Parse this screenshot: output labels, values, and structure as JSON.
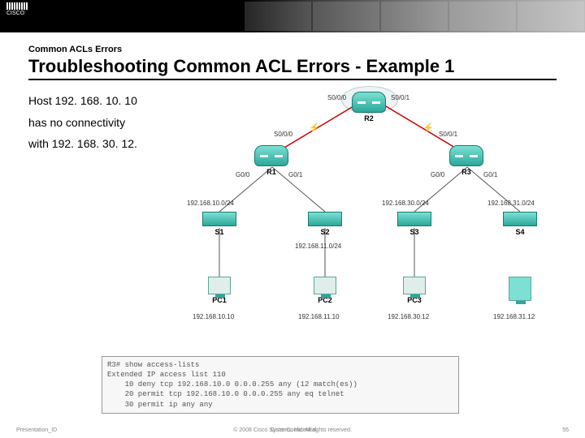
{
  "logo_text": "CISCO",
  "section_label": "Common ACLs Errors",
  "title": "Troubleshooting Common ACL Errors - Example 1",
  "body_text": {
    "l1": "Host 192. 168. 10. 10",
    "l2": "has no connectivity",
    "l3": "with 192. 168. 30. 12."
  },
  "diagram": {
    "routers": {
      "r1": "R1",
      "r2": "R2",
      "r3": "R3"
    },
    "iface": {
      "r2_s000": "S0/0/0",
      "r2_s001": "S0/0/1",
      "r1_s000": "S0/0/0",
      "r3_s001": "S0/0/1",
      "r1_g00": "G0/0",
      "r1_g01": "G0/1",
      "r3_g00": "G0/0",
      "r3_g01": "G0/1"
    },
    "switches": {
      "s1": "S1",
      "s2": "S2",
      "s3": "S3",
      "s4": "S4"
    },
    "pcs": {
      "pc1": "PC1",
      "pc2": "PC2",
      "pc3": "PC3"
    },
    "subnets": {
      "n10": "192.168.10.0/24",
      "n11": "192.168.11.0/24",
      "n30": "192.168.30.0/24",
      "n31": "192.168.31.0/24"
    },
    "hosts": {
      "h10": "192.168.10.10",
      "h11": "192.168.11.10",
      "h30": "192.168.30.12",
      "h31": "192.168.31.12"
    }
  },
  "terminal": {
    "l1": "R3# show access-lists",
    "l2": "Extended IP access list 110",
    "l3": "    10 deny tcp 192.168.10.0 0.0.0.255 any (12 match(es))",
    "l4": "    20 permit tcp 192.168.10.0 0.0.0.255 any eq telnet",
    "l5": "    30 permit ip any any"
  },
  "footer": {
    "left": "Presentation_ID",
    "center": "© 2008 Cisco Systems, Inc. All rights reserved.",
    "right": "Cisco Confidential",
    "page": "55"
  }
}
